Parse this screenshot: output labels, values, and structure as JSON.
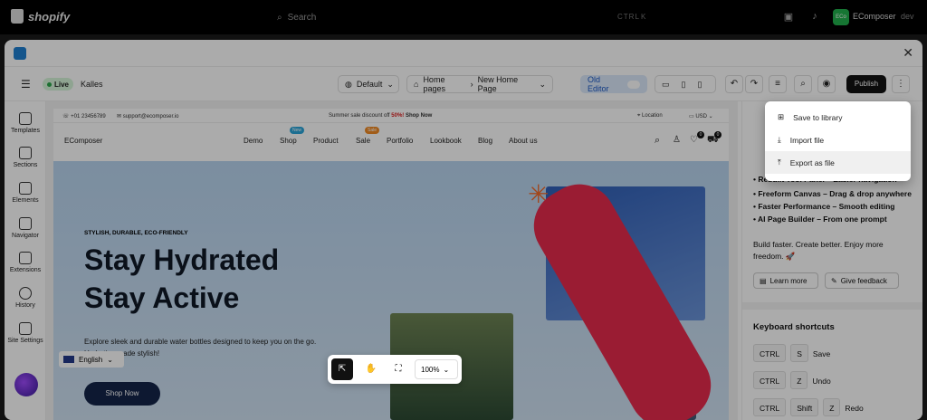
{
  "top": {
    "brand": "shopify",
    "search": "Search",
    "ctrl": "CTRL",
    "k": "K",
    "app_badge": "ECo",
    "app_name": "EComposer",
    "env": "dev"
  },
  "toolbar": {
    "live": "Live",
    "store": "Kalles",
    "default": "Default",
    "home": "Home pages",
    "page": "New Home Page",
    "old": "Old Editor",
    "publish": "Publish"
  },
  "sidebar": [
    {
      "label": "Templates"
    },
    {
      "label": "Sections"
    },
    {
      "label": "Elements"
    },
    {
      "label": "Navigator"
    },
    {
      "label": "Extensions"
    },
    {
      "label": "History"
    },
    {
      "label": "Site Settings"
    }
  ],
  "site": {
    "phone": "+01 23456789",
    "email": "support@ecomposer.io",
    "announce_pre": "Summer sale discount off ",
    "announce_pct": "50%!",
    "announce_link": "Shop Now",
    "location": "Location",
    "currency": "USD",
    "brand": "EComposer",
    "nav": [
      "Demo",
      "Shop",
      "Product",
      "Sale",
      "Portfolio",
      "Lookbook",
      "Blog",
      "About us"
    ],
    "badge_new": "New",
    "badge_sale": "Sale",
    "cart1": "0",
    "cart2": "0",
    "eyebrow": "STYLISH, DURABLE, ECO-FRIENDLY",
    "h1a": "Stay Hydrated",
    "h1b": "Stay Active",
    "body": "Explore sleek and durable water bottles designed to keep you on the go. Hydration made stylish!",
    "cta": "Shop Now",
    "lang": "English"
  },
  "canvas_tools": {
    "zoom": "100%"
  },
  "panel": {
    "items": [
      "Freeform Canvas – Drag & drop anywhere",
      "Faster Performance – Smooth editing",
      "AI Page Builder – From one prompt"
    ],
    "partial": "Rebuilt Tool Panel – Easier navigation",
    "tagline": "Build faster. Create better. Enjoy more freedom. 🚀",
    "learn": "Learn more",
    "feedback": "Give feedback",
    "shortcuts": "Keyboard shortcuts",
    "keys": [
      {
        "k": [
          "CTRL",
          "S"
        ],
        "label": "Save"
      },
      {
        "k": [
          "CTRL",
          "Z"
        ],
        "label": "Undo"
      },
      {
        "k": [
          "CTRL",
          "Shift",
          "Z"
        ],
        "label": "Redo"
      }
    ]
  },
  "menu": {
    "items": [
      {
        "label": "Save to library",
        "icon": "save-library-icon"
      },
      {
        "label": "Import file",
        "icon": "import-icon"
      },
      {
        "label": "Export as file",
        "icon": "export-icon"
      }
    ]
  }
}
